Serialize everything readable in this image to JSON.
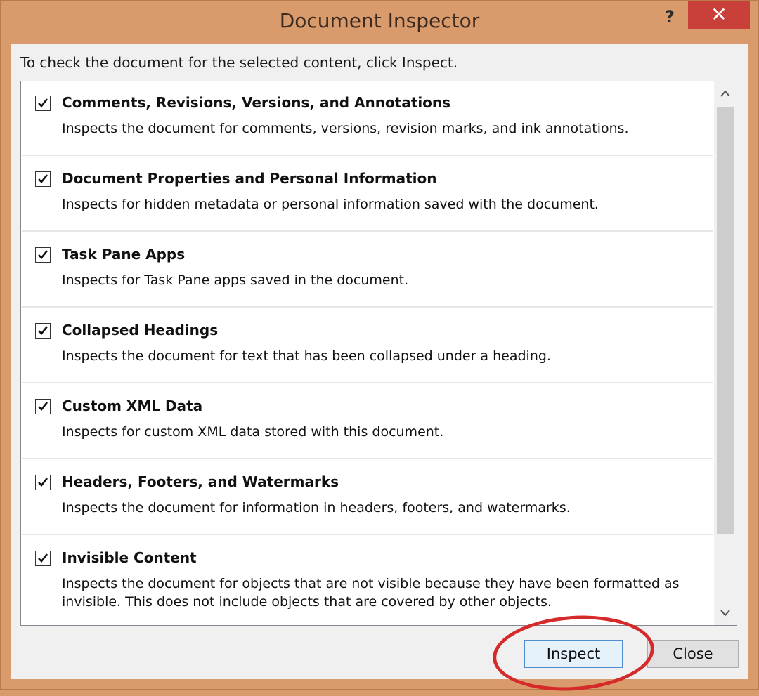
{
  "window": {
    "title": "Document Inspector",
    "help_label": "?",
    "close_label": "✕"
  },
  "instruction": "To check the document for the selected content, click Inspect.",
  "items": [
    {
      "title": "Comments, Revisions, Versions, and Annotations",
      "desc": "Inspects the document for comments, versions, revision marks, and ink annotations.",
      "checked": true
    },
    {
      "title": "Document Properties and Personal Information",
      "desc": "Inspects for hidden metadata or personal information saved with the document.",
      "checked": true
    },
    {
      "title": "Task Pane Apps",
      "desc": "Inspects for Task Pane apps saved in the document.",
      "checked": true
    },
    {
      "title": "Collapsed Headings",
      "desc": "Inspects the document for text that has been collapsed under a heading.",
      "checked": true
    },
    {
      "title": "Custom XML Data",
      "desc": "Inspects for custom XML data stored with this document.",
      "checked": true
    },
    {
      "title": "Headers, Footers, and Watermarks",
      "desc": "Inspects the document for information in headers, footers, and watermarks.",
      "checked": true
    },
    {
      "title": "Invisible Content",
      "desc": "Inspects the document for objects that are not visible because they have been formatted as invisible. This does not include objects that are covered by other objects.",
      "checked": true
    }
  ],
  "buttons": {
    "inspect_label": "Inspect",
    "close_label": "Close"
  },
  "colors": {
    "frame": "#d99a6c",
    "close_button": "#c9403a",
    "annotation_circle": "#d62a2a"
  }
}
